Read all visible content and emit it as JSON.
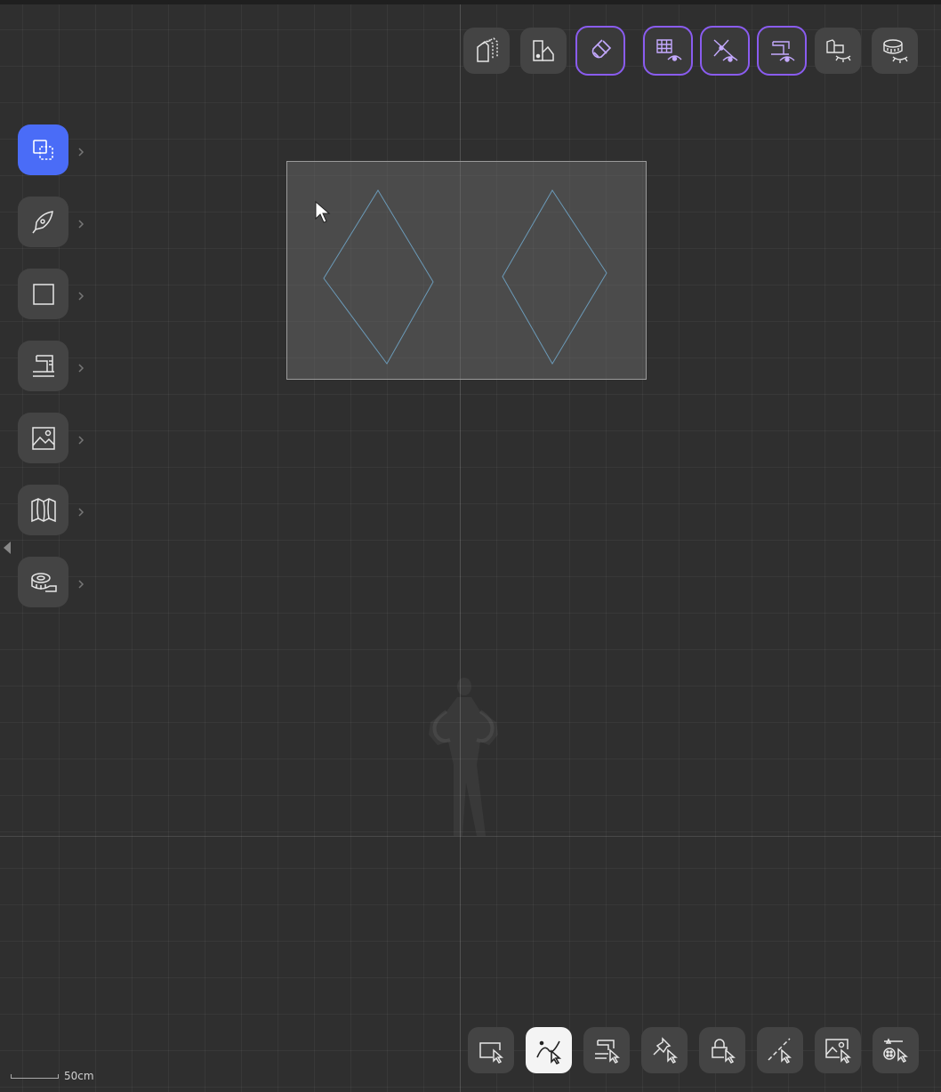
{
  "top_toolbar": {
    "buttons": [
      {
        "name": "pieces-stack",
        "active": false
      },
      {
        "name": "fabric-swatch",
        "active": false
      },
      {
        "name": "magnet",
        "active": true
      },
      {
        "name": "grid-visibility",
        "active": true
      },
      {
        "name": "points-visibility",
        "active": true
      },
      {
        "name": "sewing-visibility",
        "active": true
      },
      {
        "name": "pieces-hidden",
        "active": false
      },
      {
        "name": "measure-hidden",
        "active": false
      }
    ],
    "accent_color": "#8a5cf0"
  },
  "left_toolbar": {
    "tools": [
      {
        "name": "select-tool",
        "active": true
      },
      {
        "name": "pen-tool",
        "active": false
      },
      {
        "name": "rectangle-tool",
        "active": false
      },
      {
        "name": "sewing-tool",
        "active": false
      },
      {
        "name": "image-tool",
        "active": false
      },
      {
        "name": "map-tool",
        "active": false
      },
      {
        "name": "measure-tool",
        "active": false
      }
    ],
    "accent_color": "#4a6cf7"
  },
  "bottom_toolbar": {
    "tools": [
      {
        "name": "select-piece",
        "active": false
      },
      {
        "name": "select-curve",
        "active": true
      },
      {
        "name": "select-seam",
        "active": false
      },
      {
        "name": "select-pin",
        "active": false
      },
      {
        "name": "select-lock",
        "active": false
      },
      {
        "name": "select-line",
        "active": false
      },
      {
        "name": "select-image",
        "active": false
      },
      {
        "name": "select-button",
        "active": false
      }
    ]
  },
  "scale": {
    "label": "50cm"
  }
}
